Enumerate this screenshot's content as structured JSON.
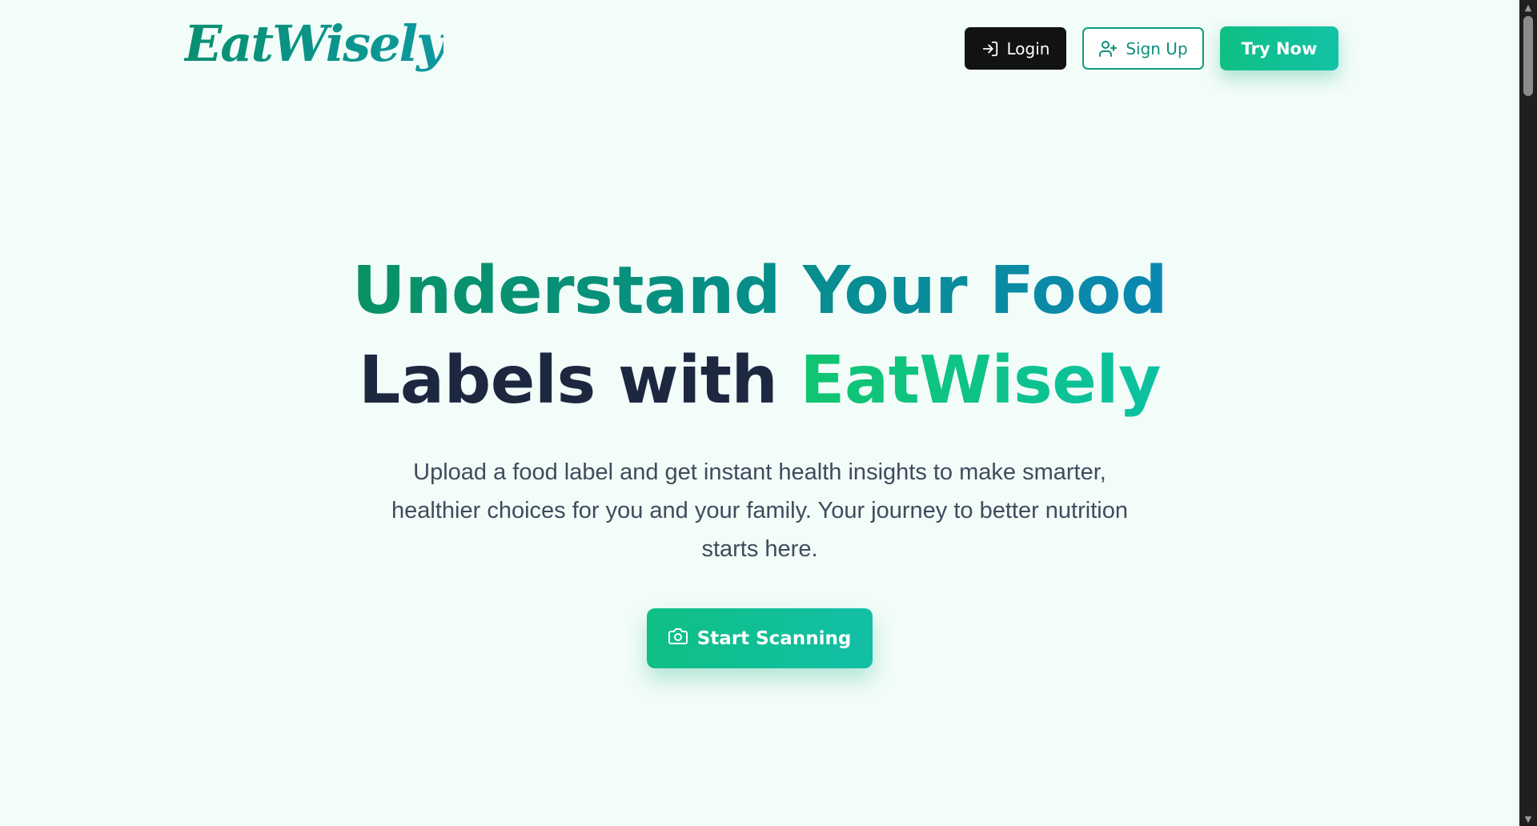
{
  "header": {
    "logo_text": "EatWisely",
    "login_label": "Login",
    "signup_label": "Sign Up",
    "try_label": "Try Now"
  },
  "hero": {
    "headline_part1": "Understand Your Food",
    "headline_part2": "Labels with",
    "headline_brand": "EatWisely",
    "subtitle": "Upload a food label and get instant health insights to make smarter, healthier choices for you and your family. Your journey to better nutrition starts here.",
    "cta_label": "Start Scanning"
  },
  "icons": {
    "login": "login-arrow-icon",
    "signup": "user-plus-icon",
    "cta": "camera-icon"
  },
  "colors": {
    "background": "#f2fcf8",
    "brand_green": "#10bf84",
    "teal": "#0e98a0",
    "dark_text": "#1c2740",
    "login_button": "#111214"
  }
}
